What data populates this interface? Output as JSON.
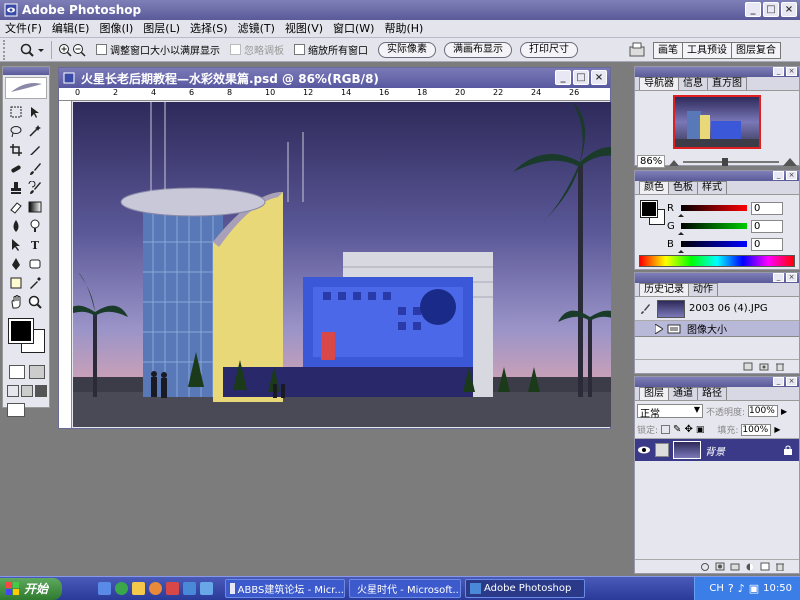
{
  "app": {
    "title": "Adobe Photoshop",
    "window_buttons": [
      "_",
      "□",
      "×"
    ]
  },
  "menubar": [
    "文件(F)",
    "编辑(E)",
    "图像(I)",
    "图层(L)",
    "选择(S)",
    "滤镜(T)",
    "视图(V)",
    "窗口(W)",
    "帮助(H)"
  ],
  "options": {
    "resize_windows": "调整窗口大小以满屏显示",
    "ignore_palettes": "忽略调板",
    "zoom_all_windows": "缩放所有窗口",
    "actual_pixels": "实际像素",
    "fit_on_screen": "满画布显示",
    "print_size": "打印尺寸",
    "palette_tabs": [
      "画笔",
      "工具预设",
      "图层复合"
    ]
  },
  "document": {
    "title": "火星长老后期教程—水彩效果篇.psd @ 86%(RGB/8)",
    "ruler_marks": [
      "0",
      "2",
      "4",
      "6",
      "8",
      "10",
      "12",
      "14",
      "16",
      "18",
      "20",
      "22",
      "24",
      "26"
    ]
  },
  "navigator": {
    "tabs": [
      "导航器",
      "信息",
      "直方图"
    ],
    "zoom": "86%"
  },
  "color": {
    "tabs": [
      "颜色",
      "色板",
      "样式"
    ],
    "channels": [
      {
        "label": "R",
        "value": "0"
      },
      {
        "label": "G",
        "value": "0"
      },
      {
        "label": "B",
        "value": "0"
      }
    ]
  },
  "history": {
    "tabs": [
      "历史记录",
      "动作"
    ],
    "snapshot": "2003 06 (4).JPG",
    "step": "图像大小"
  },
  "layers": {
    "tabs": [
      "图层",
      "通道",
      "路径"
    ],
    "blend_mode": "正常",
    "opacity_label": "不透明度:",
    "opacity": "100%",
    "lock_label": "锁定:",
    "fill_label": "填充:",
    "fill": "100%",
    "layer_name": "背景"
  },
  "taskbar": {
    "start": "开始",
    "tasks": [
      {
        "label": "ABBS建筑论坛 - Micr..."
      },
      {
        "label": "火星时代 - Microsoft..."
      },
      {
        "label": "Adobe Photoshop"
      }
    ],
    "lang": "CH",
    "time": "10:50"
  },
  "colors": {
    "title_blue": "#5a5a99",
    "panel_bg": "#e6e6ee",
    "taskbar": "#2a3a98"
  }
}
